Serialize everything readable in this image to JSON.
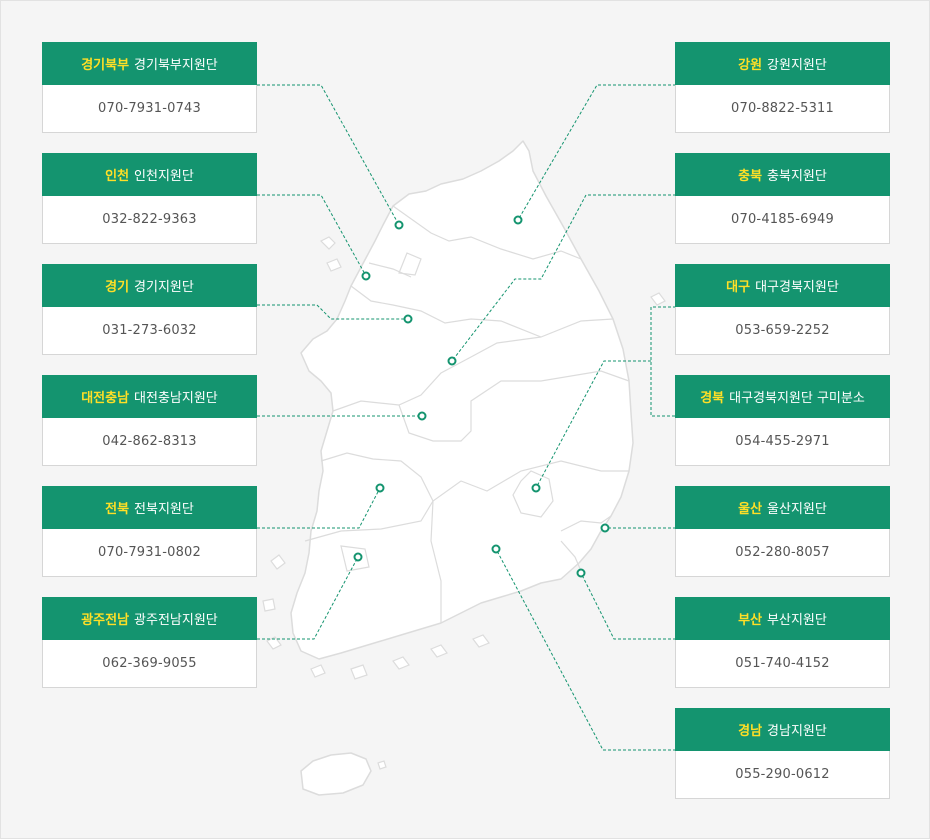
{
  "colors": {
    "accent": "#14946f",
    "region_highlight": "#ffdf26",
    "line": "#14946f",
    "map_fill": "#ffffff",
    "map_stroke": "#dcdcdc",
    "background": "#f5f5f5"
  },
  "offices": [
    {
      "id": "gyeonggi-north",
      "region": "경기북부",
      "name": "경기북부지원단",
      "phone": "070-7931-0743"
    },
    {
      "id": "incheon",
      "region": "인천",
      "name": "인천지원단",
      "phone": "032-822-9363"
    },
    {
      "id": "gyeonggi",
      "region": "경기",
      "name": "경기지원단",
      "phone": "031-273-6032"
    },
    {
      "id": "daejeon-chungnam",
      "region": "대전충남",
      "name": "대전충남지원단",
      "phone": "042-862-8313"
    },
    {
      "id": "jeonbuk",
      "region": "전북",
      "name": "전북지원단",
      "phone": "070-7931-0802"
    },
    {
      "id": "gwangju-jeonnam",
      "region": "광주전남",
      "name": "광주전남지원단",
      "phone": "062-369-9055"
    },
    {
      "id": "gangwon",
      "region": "강원",
      "name": "강원지원단",
      "phone": "070-8822-5311"
    },
    {
      "id": "chungbuk",
      "region": "충북",
      "name": "충북지원단",
      "phone": "070-4185-6949"
    },
    {
      "id": "daegu",
      "region": "대구",
      "name": "대구경북지원단",
      "phone": "053-659-2252"
    },
    {
      "id": "gyeongbuk",
      "region": "경북",
      "name": "대구경북지원단 구미분소",
      "phone": "054-455-2971"
    },
    {
      "id": "ulsan",
      "region": "울산",
      "name": "울산지원단",
      "phone": "052-280-8057"
    },
    {
      "id": "busan",
      "region": "부산",
      "name": "부산지원단",
      "phone": "051-740-4152"
    },
    {
      "id": "gyeongnam",
      "region": "경남",
      "name": "경남지원단",
      "phone": "055-290-0612"
    }
  ]
}
